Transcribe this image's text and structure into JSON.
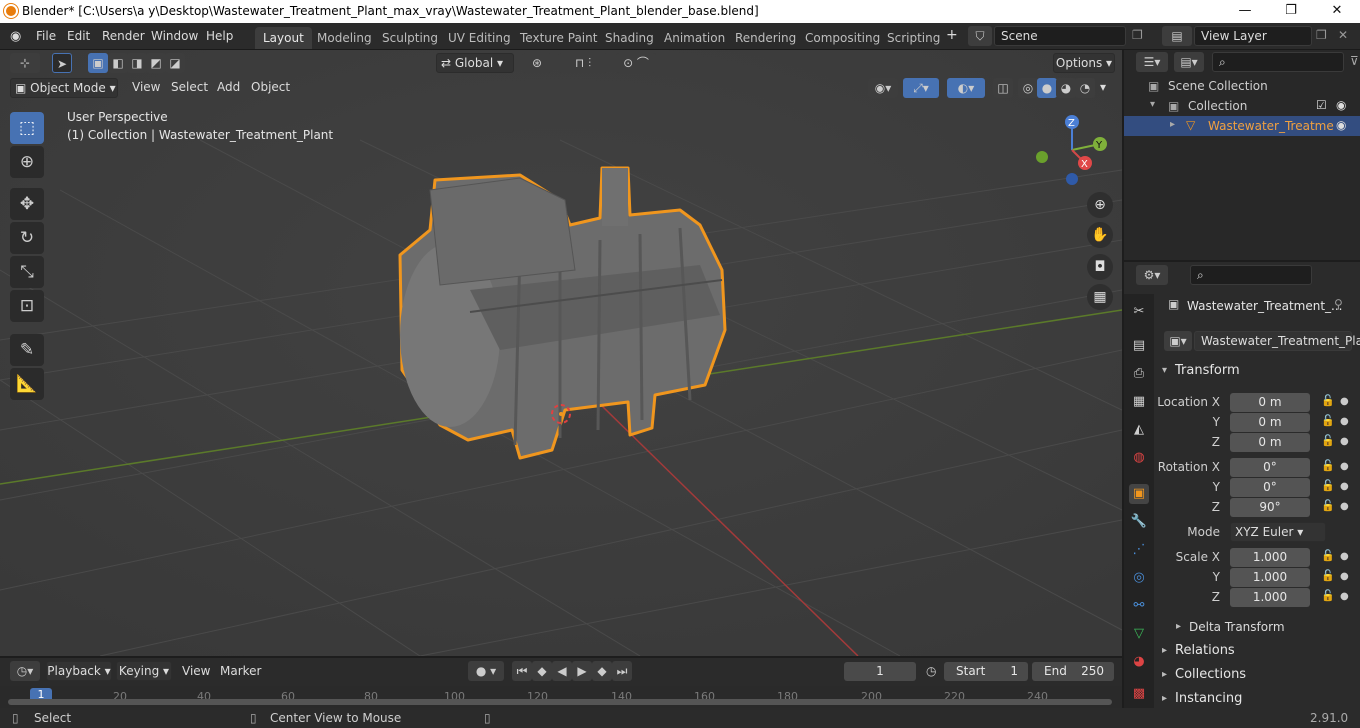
{
  "window": {
    "title": "Blender* [C:\\Users\\a y\\Desktop\\Wastewater_Treatment_Plant_max_vray\\Wastewater_Treatment_Plant_blender_base.blend]"
  },
  "menu": [
    "File",
    "Edit",
    "Render",
    "Window",
    "Help"
  ],
  "workspaces": [
    "Layout",
    "Modeling",
    "Sculpting",
    "UV Editing",
    "Texture Paint",
    "Shading",
    "Animation",
    "Rendering",
    "Compositing",
    "Scripting"
  ],
  "scene": {
    "name": "Scene",
    "view_layer": "View Layer"
  },
  "header": {
    "transform_orientation": "Global",
    "options": "Options",
    "mode": "Object Mode",
    "menus": [
      "View",
      "Select",
      "Add",
      "Object"
    ]
  },
  "viewport": {
    "perspective": "User Perspective",
    "collection_info": "(1) Collection | Wastewater_Treatment_Plant"
  },
  "gizmo": {
    "x": "X",
    "y": "Y",
    "z": "Z"
  },
  "outliner": {
    "root": "Scene Collection",
    "collection": "Collection",
    "object": "Wastewater_Treatme"
  },
  "properties": {
    "object_name": "Wastewater_Treatment_...",
    "data_name": "Wastewater_Treatment_Plant",
    "transform_label": "Transform",
    "location": {
      "label_x": "Location X",
      "label_y": "Y",
      "label_z": "Z",
      "x": "0 m",
      "y": "0 m",
      "z": "0 m"
    },
    "rotation": {
      "label_x": "Rotation X",
      "label_y": "Y",
      "label_z": "Z",
      "x": "0°",
      "y": "0°",
      "z": "90°"
    },
    "mode_label": "Mode",
    "mode": "XYZ Euler",
    "scale": {
      "label_x": "Scale X",
      "label_y": "Y",
      "label_z": "Z",
      "x": "1.000",
      "y": "1.000",
      "z": "1.000"
    },
    "delta": "Delta Transform",
    "sections": [
      "Relations",
      "Collections",
      "Instancing"
    ]
  },
  "timeline": {
    "menus": [
      "Playback",
      "Keying",
      "View",
      "Marker"
    ],
    "current_frame": "1",
    "start_label": "Start",
    "start": "1",
    "end_label": "End",
    "end": "250",
    "ticks": [
      "1",
      "20",
      "40",
      "60",
      "80",
      "100",
      "120",
      "140",
      "160",
      "180",
      "200",
      "220",
      "240"
    ]
  },
  "status": {
    "select": "Select",
    "center": "Center View to Mouse",
    "version": "2.91.0"
  }
}
